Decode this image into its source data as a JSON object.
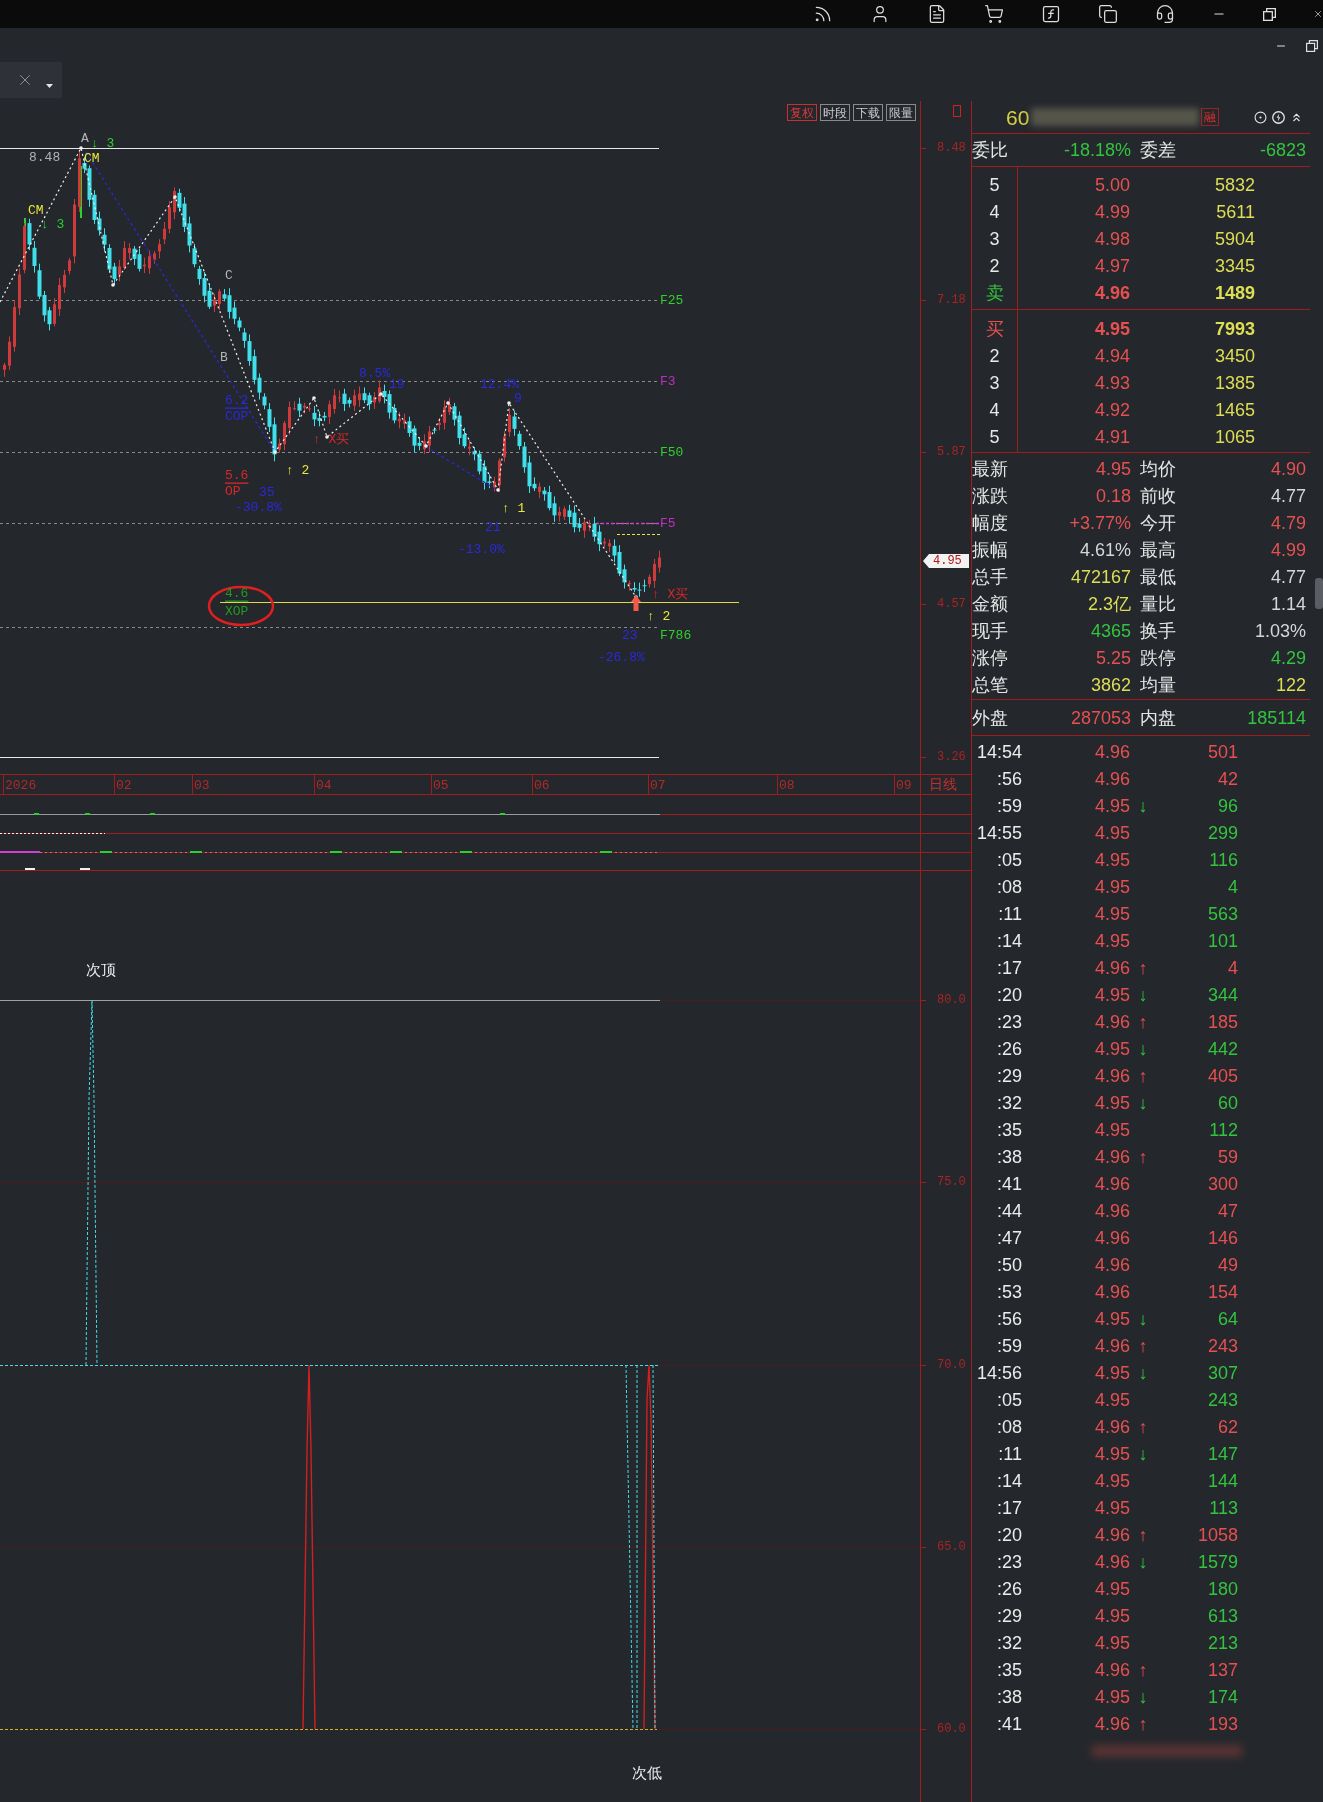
{
  "toolbar": {
    "buttons": [
      {
        "label": "复权",
        "selected": true
      },
      {
        "label": "时段",
        "selected": false
      },
      {
        "label": "下载",
        "selected": false
      },
      {
        "label": "限量",
        "selected": false
      }
    ]
  },
  "price_chart": {
    "price_axis": [
      "8.48",
      "7.18",
      "5.87",
      "4.57",
      "3.26"
    ],
    "current_price": "4.95",
    "fib_levels": [
      {
        "label": "F25",
        "color": "#2ed02e"
      },
      {
        "label": "F3",
        "color": "#c030c0"
      },
      {
        "label": "F50",
        "color": "#2ed02e"
      },
      {
        "label": "F5",
        "color": "#c030c0"
      },
      {
        "label": "F786",
        "color": "#2ed02e"
      }
    ],
    "annotations": [
      {
        "text": "A",
        "color": "#b4b4b4",
        "underlined": false
      },
      {
        "text": "↓ 3",
        "color": "#2ed02e",
        "underlined": false
      },
      {
        "text": "8.48",
        "color": "#b4b4b4",
        "underlined": false
      },
      {
        "text": "CM",
        "color": "#e8e83a",
        "underlined": false
      },
      {
        "text": "CM",
        "color": "#e8e83a",
        "underlined": false
      },
      {
        "text": "↓ 3",
        "color": "#2ed02e",
        "underlined": false
      },
      {
        "text": "C",
        "color": "#b4b4b4",
        "underlined": false
      },
      {
        "text": "B",
        "color": "#b4b4b4",
        "underlined": false
      },
      {
        "text": "8.5%",
        "color": "#2a2ad8",
        "underlined": false
      },
      {
        "text": "19",
        "color": "#2a2ad8",
        "underlined": false
      },
      {
        "text": "12.4%",
        "color": "#2a2ad8",
        "underlined": false
      },
      {
        "text": "9",
        "color": "#2a2ad8",
        "underlined": false
      },
      {
        "text": "6.2",
        "color": "#2a2ad8",
        "underlined": true
      },
      {
        "text": "COP",
        "color": "#2a2ad8",
        "underlined": false
      },
      {
        "text": "↑ X买",
        "color": "#d82828",
        "underlined": false
      },
      {
        "text": "↑ 2",
        "color": "#e8e83a",
        "underlined": false
      },
      {
        "text": "5.6",
        "color": "#d82828",
        "underlined": true
      },
      {
        "text": "OP",
        "color": "#d82828",
        "underlined": false
      },
      {
        "text": "35",
        "color": "#2a2ad8",
        "underlined": false
      },
      {
        "text": "-30.8%",
        "color": "#2a2ad8",
        "underlined": false
      },
      {
        "text": "↑ 1",
        "color": "#e8e83a",
        "underlined": false
      },
      {
        "text": "21",
        "color": "#2a2ad8",
        "underlined": false
      },
      {
        "text": "-13.0%",
        "color": "#2a2ad8",
        "underlined": false
      },
      {
        "text": "4.6",
        "color": "#229a22",
        "underlined": true
      },
      {
        "text": "XOP",
        "color": "#229a22",
        "underlined": false
      },
      {
        "text": "↑ X买",
        "color": "#d82828",
        "underlined": false
      },
      {
        "text": "↑ 2",
        "color": "#e8e83a",
        "underlined": false
      },
      {
        "text": "23",
        "color": "#2a2ad8",
        "underlined": false
      },
      {
        "text": "-26.8%",
        "color": "#2a2ad8",
        "underlined": false
      }
    ],
    "date_axis": [
      "2026",
      "02",
      "03",
      "04",
      "05",
      "06",
      "07",
      "08",
      "09"
    ],
    "period": "日线"
  },
  "indicator": {
    "axis": [
      "80.0",
      "75.0",
      "70.0",
      "65.0",
      "60.0"
    ],
    "top_label": "次顶",
    "bottom_label": "次低"
  },
  "quote": {
    "code": "60",
    "badge": "融",
    "order_stats": [
      {
        "label": "委比",
        "value": "-18.18%",
        "color": "#33c43f"
      },
      {
        "label": "委差",
        "value": "-6823",
        "color": "#33c43f"
      }
    ],
    "asks": [
      {
        "level": "5",
        "price": "5.00",
        "volume": "5832",
        "best": false
      },
      {
        "level": "4",
        "price": "4.99",
        "volume": "5611",
        "best": false
      },
      {
        "level": "3",
        "price": "4.98",
        "volume": "5904",
        "best": false
      },
      {
        "level": "2",
        "price": "4.97",
        "volume": "3345",
        "best": false
      },
      {
        "level": "卖",
        "price": "4.96",
        "volume": "1489",
        "best": true
      }
    ],
    "bids": [
      {
        "level": "买",
        "price": "4.95",
        "volume": "7993",
        "best": true
      },
      {
        "level": "2",
        "price": "4.94",
        "volume": "3450",
        "best": false
      },
      {
        "level": "3",
        "price": "4.93",
        "volume": "1385",
        "best": false
      },
      {
        "level": "4",
        "price": "4.92",
        "volume": "1465",
        "best": false
      },
      {
        "level": "5",
        "price": "4.91",
        "volume": "1065",
        "best": false
      }
    ],
    "stats": [
      {
        "label": "最新",
        "value": "4.95",
        "color": "#e65050"
      },
      {
        "label": "均价",
        "value": "4.90",
        "color": "#e65050"
      },
      {
        "label": "涨跌",
        "value": "0.18",
        "color": "#e65050"
      },
      {
        "label": "前收",
        "value": "4.77",
        "color": "#d6d6d6"
      },
      {
        "label": "幅度",
        "value": "+3.77%",
        "color": "#e65050"
      },
      {
        "label": "今开",
        "value": "4.79",
        "color": "#e65050"
      },
      {
        "label": "振幅",
        "value": "4.61%",
        "color": "#d6d6d6"
      },
      {
        "label": "最高",
        "value": "4.99",
        "color": "#e65050"
      },
      {
        "label": "总手",
        "value": "472167",
        "color": "#dede55"
      },
      {
        "label": "最低",
        "value": "4.77",
        "color": "#d6d6d6"
      },
      {
        "label": "金额",
        "value": "2.3亿",
        "color": "#dede55"
      },
      {
        "label": "量比",
        "value": "1.14",
        "color": "#d6d6d6"
      },
      {
        "label": "现手",
        "value": "4365",
        "color": "#33c43f"
      },
      {
        "label": "换手",
        "value": "1.03%",
        "color": "#d6d6d6"
      },
      {
        "label": "涨停",
        "value": "5.25",
        "color": "#e65050"
      },
      {
        "label": "跌停",
        "value": "4.29",
        "color": "#33c43f"
      },
      {
        "label": "总笔",
        "value": "3862",
        "color": "#dede55"
      },
      {
        "label": "均量",
        "value": "122",
        "color": "#dede55"
      }
    ],
    "flow": [
      {
        "label": "外盘",
        "value": "287053",
        "color": "#e65050"
      },
      {
        "label": "内盘",
        "value": "185114",
        "color": "#33c43f"
      }
    ]
  },
  "ticks": [
    {
      "time": "14:54",
      "price": "4.96",
      "volume": "501",
      "color": "#e65050"
    },
    {
      "time": ":56",
      "price": "4.96",
      "volume": "42",
      "color": "#e65050"
    },
    {
      "time": ":59",
      "price": "4.95",
      "arrow": "↓",
      "volume": "96",
      "color": "#33c43f"
    },
    {
      "time": "14:55",
      "price": "4.95",
      "volume": "299",
      "color": "#33c43f"
    },
    {
      "time": ":05",
      "price": "4.95",
      "volume": "116",
      "color": "#33c43f"
    },
    {
      "time": ":08",
      "price": "4.95",
      "volume": "4",
      "color": "#33c43f"
    },
    {
      "time": ":11",
      "price": "4.95",
      "volume": "563",
      "color": "#33c43f"
    },
    {
      "time": ":14",
      "price": "4.95",
      "volume": "101",
      "color": "#33c43f"
    },
    {
      "time": ":17",
      "price": "4.96",
      "arrow": "↑",
      "volume": "4",
      "color": "#e65050"
    },
    {
      "time": ":20",
      "price": "4.95",
      "arrow": "↓",
      "volume": "344",
      "color": "#33c43f"
    },
    {
      "time": ":23",
      "price": "4.96",
      "arrow": "↑",
      "volume": "185",
      "color": "#e65050"
    },
    {
      "time": ":26",
      "price": "4.95",
      "arrow": "↓",
      "volume": "442",
      "color": "#33c43f"
    },
    {
      "time": ":29",
      "price": "4.96",
      "arrow": "↑",
      "volume": "405",
      "color": "#e65050"
    },
    {
      "time": ":32",
      "price": "4.95",
      "arrow": "↓",
      "volume": "60",
      "color": "#33c43f"
    },
    {
      "time": ":35",
      "price": "4.95",
      "volume": "112",
      "color": "#33c43f"
    },
    {
      "time": ":38",
      "price": "4.96",
      "arrow": "↑",
      "volume": "59",
      "color": "#e65050"
    },
    {
      "time": ":41",
      "price": "4.96",
      "volume": "300",
      "color": "#e65050"
    },
    {
      "time": ":44",
      "price": "4.96",
      "volume": "47",
      "color": "#e65050"
    },
    {
      "time": ":47",
      "price": "4.96",
      "volume": "146",
      "color": "#e65050"
    },
    {
      "time": ":50",
      "price": "4.96",
      "volume": "49",
      "color": "#e65050"
    },
    {
      "time": ":53",
      "price": "4.96",
      "volume": "154",
      "color": "#e65050"
    },
    {
      "time": ":56",
      "price": "4.95",
      "arrow": "↓",
      "volume": "64",
      "color": "#33c43f"
    },
    {
      "time": ":59",
      "price": "4.96",
      "arrow": "↑",
      "volume": "243",
      "color": "#e65050"
    },
    {
      "time": "14:56",
      "price": "4.95",
      "arrow": "↓",
      "volume": "307",
      "color": "#33c43f"
    },
    {
      "time": ":05",
      "price": "4.95",
      "volume": "243",
      "color": "#33c43f"
    },
    {
      "time": ":08",
      "price": "4.96",
      "arrow": "↑",
      "volume": "62",
      "color": "#e65050"
    },
    {
      "time": ":11",
      "price": "4.95",
      "arrow": "↓",
      "volume": "147",
      "color": "#33c43f"
    },
    {
      "time": ":14",
      "price": "4.95",
      "volume": "144",
      "color": "#33c43f"
    },
    {
      "time": ":17",
      "price": "4.95",
      "volume": "113",
      "color": "#33c43f"
    },
    {
      "time": ":20",
      "price": "4.96",
      "arrow": "↑",
      "volume": "1058",
      "color": "#e65050"
    },
    {
      "time": ":23",
      "price": "4.96",
      "arrow": "↓",
      "volume": "1579",
      "color": "#33c43f"
    },
    {
      "time": ":26",
      "price": "4.95",
      "volume": "180",
      "color": "#33c43f"
    },
    {
      "time": ":29",
      "price": "4.95",
      "volume": "613",
      "color": "#33c43f"
    },
    {
      "time": ":32",
      "price": "4.95",
      "volume": "213",
      "color": "#33c43f"
    },
    {
      "time": ":35",
      "price": "4.96",
      "arrow": "↑",
      "volume": "137",
      "color": "#e65050"
    },
    {
      "time": ":38",
      "price": "4.95",
      "arrow": "↓",
      "volume": "174",
      "color": "#33c43f"
    },
    {
      "time": ":41",
      "price": "4.96",
      "arrow": "↑",
      "volume": "193",
      "color": "#e65050"
    }
  ]
}
